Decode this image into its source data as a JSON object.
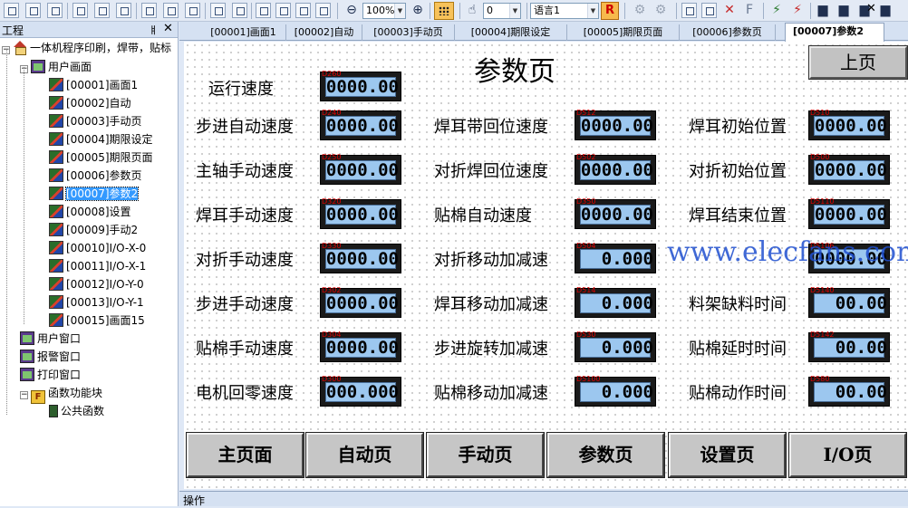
{
  "toolbar": {
    "zoom": "100%",
    "layer": "0",
    "language": "语言1",
    "r_label": "R",
    "f_label": "F"
  },
  "project_pane": {
    "title": "工程",
    "pin": "ㅒ",
    "close": "✕",
    "tree": {
      "root": "一体机程序印刷，焊带，贴标",
      "user_screens": "用户画面",
      "screens": [
        "[00001]画面1",
        "[00002]自动",
        "[00003]手动页",
        "[00004]期限设定",
        "[00005]期限页面",
        "[00006]参数页",
        "[00007]参数2",
        "[00008]设置",
        "[00009]手动2",
        "[00010]I/O-X-0",
        "[00011]I/O-X-1",
        "[00012]I/O-Y-0",
        "[00013]I/O-Y-1",
        "[00015]画面15"
      ],
      "selected_index": 6,
      "user_window": "用户窗口",
      "alarm_window": "报警窗口",
      "print_window": "打印窗口",
      "function_block": "函数功能块",
      "public_function": "公共函数"
    }
  },
  "tabs": [
    "[00001]画面1",
    "[00002]自动",
    "[00003]手动页",
    "[00004]期限设定",
    "[00005]期限页面",
    "[00006]参数页",
    "[00007]参数2"
  ],
  "tab_close": "✕",
  "page": {
    "title": "参数页",
    "prev_button": "上页",
    "run_speed_label": "运行速度",
    "run_speed_value": "0000.00",
    "run_speed_addr": "D260",
    "col1": [
      {
        "label": "步进自动速度",
        "value": "0000.00",
        "addr": "D240"
      },
      {
        "label": "主轴手动速度",
        "value": "0000.00",
        "addr": "D250"
      },
      {
        "label": "焊耳手动速度",
        "value": "0000.00",
        "addr": "D320"
      },
      {
        "label": "对折手动速度",
        "value": "0000.00",
        "addr": "D330"
      },
      {
        "label": "步进手动速度",
        "value": "0000.00",
        "addr": "D302"
      },
      {
        "label": "贴棉手动速度",
        "value": "0000.00",
        "addr": "D304"
      },
      {
        "label": "电机回零速度",
        "value": "000.000",
        "addr": "D300"
      }
    ],
    "col2": [
      {
        "label": "焊耳带回位速度",
        "value": "0000.00",
        "addr": "D512"
      },
      {
        "label": "对折焊回位速度",
        "value": "0000.00",
        "addr": "D502"
      },
      {
        "label": "贴棉自动速度",
        "value": "0000.00",
        "addr": "D350"
      },
      {
        "label": "对折移动加减速",
        "value": "0.000",
        "addr": "D504"
      },
      {
        "label": "焊耳移动加减速",
        "value": "0.000",
        "addr": "D514"
      },
      {
        "label": "步进旋转加减速",
        "value": "0.000",
        "addr": "D530"
      },
      {
        "label": "贴棉移动加减速",
        "value": "0.000",
        "addr": "D5100"
      }
    ],
    "col3": [
      {
        "label": "焊耳初始位置",
        "value": "0000.00",
        "addr": "D510"
      },
      {
        "label": "对折初始位置",
        "value": "0000.00",
        "addr": "D500"
      },
      {
        "label": "焊耳结束位置",
        "value": "0000.00",
        "addr": "D5110"
      },
      {
        "label": "",
        "value": "0000.00",
        "addr": "D5106"
      },
      {
        "label": "料架缺料时间",
        "value": "00.00",
        "addr": "D5140"
      },
      {
        "label": "贴棉延时时间",
        "value": "00.00",
        "addr": "D5142"
      },
      {
        "label": "贴棉动作时间",
        "value": "00.00",
        "addr": "D580"
      }
    ],
    "nav": [
      "主页面",
      "自动页",
      "手动页",
      "参数页",
      "设置页",
      "I/O页"
    ]
  },
  "watermark": "www.elecfans.com",
  "bottom_bar": "操作"
}
